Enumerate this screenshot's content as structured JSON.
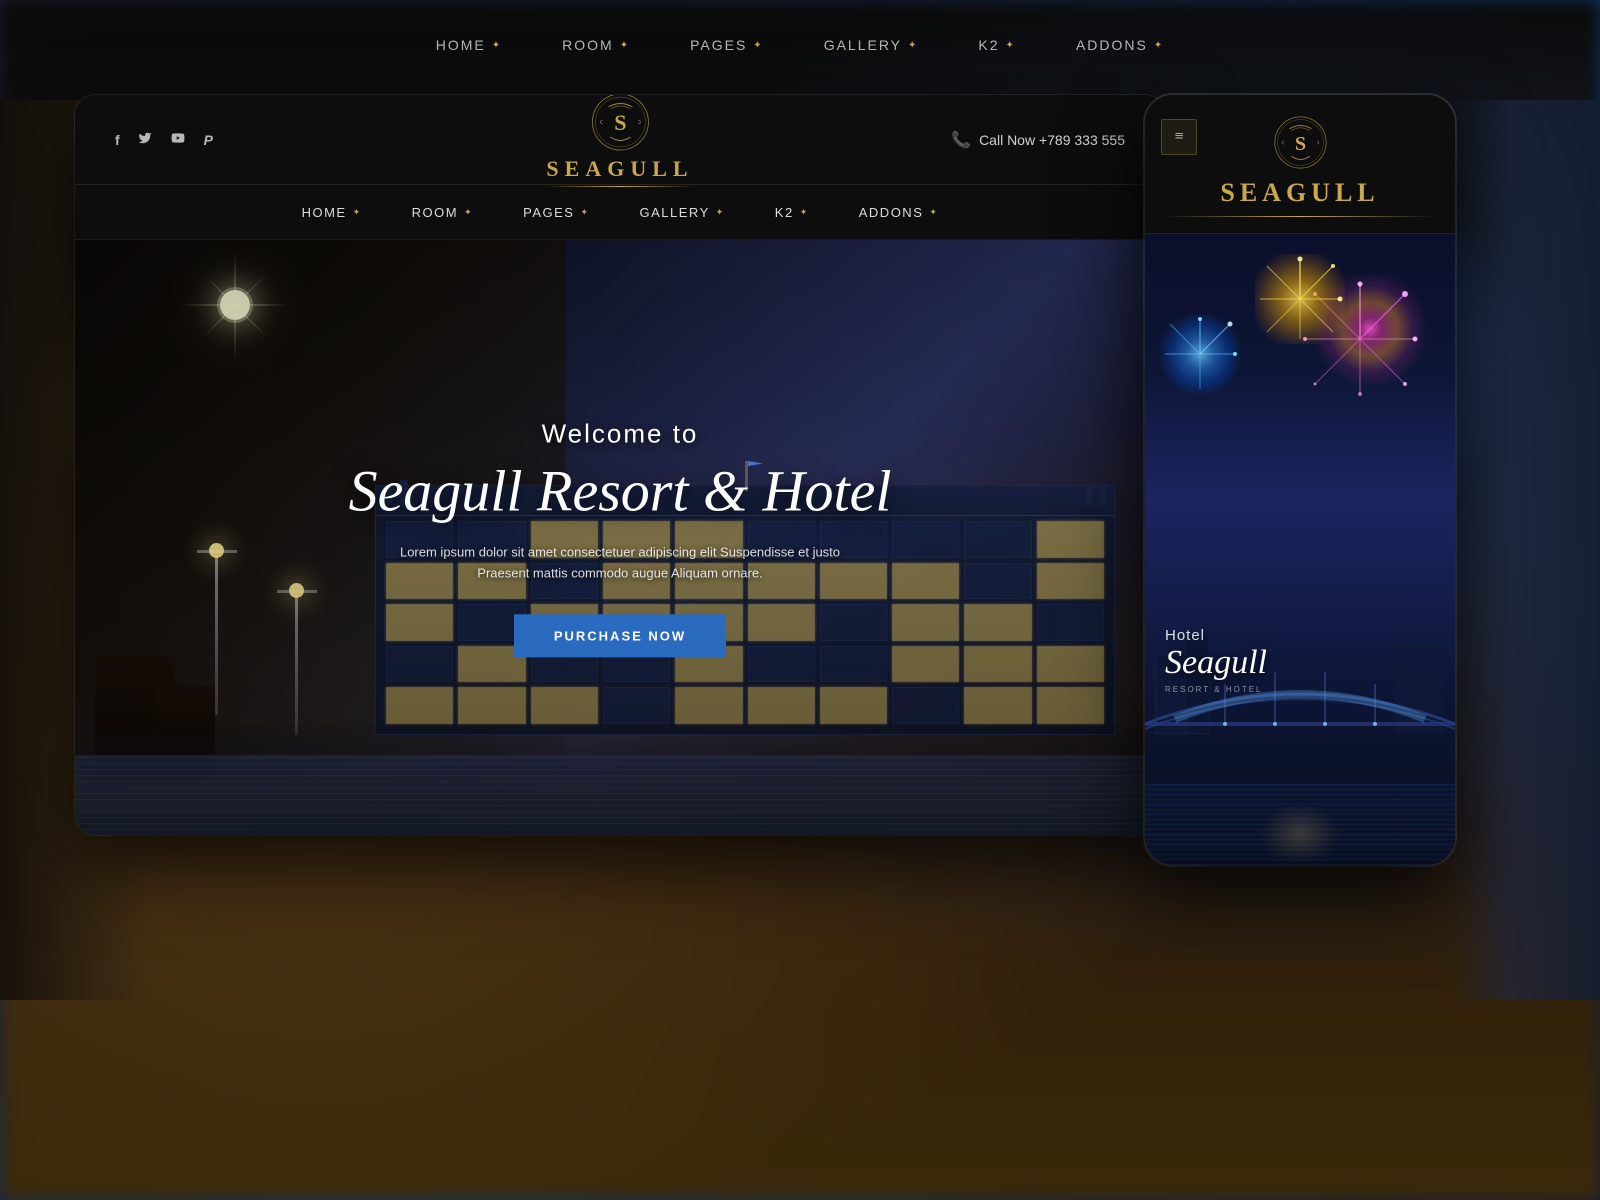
{
  "site": {
    "name": "SEAGULL",
    "tagline": "Hotel Seagull",
    "mobile_hotel_label": "Hotel",
    "mobile_hotel_name": "Seagull",
    "mobile_tagline": "RESORT & HOTEL",
    "call_now": "Call Now +789 333 555",
    "phone": "+789 333 555"
  },
  "header": {
    "social": {
      "facebook": "f",
      "twitter": "🐦",
      "youtube": "▶",
      "pinterest": "P"
    }
  },
  "top_nav": {
    "items": [
      {
        "label": "HOME",
        "has_arrow": true
      },
      {
        "label": "ROOM",
        "has_arrow": true
      },
      {
        "label": "PAGES",
        "has_arrow": true
      },
      {
        "label": "GALLERY",
        "has_arrow": true
      },
      {
        "label": "K2",
        "has_arrow": true
      },
      {
        "label": "ADDONS",
        "has_arrow": true
      }
    ]
  },
  "main_nav": {
    "items": [
      {
        "label": "HOME",
        "has_arrow": true
      },
      {
        "label": "ROOM",
        "has_arrow": true
      },
      {
        "label": "PAGES",
        "has_arrow": true
      },
      {
        "label": "GALLERY",
        "has_arrow": true
      },
      {
        "label": "K2",
        "has_arrow": true
      },
      {
        "label": "ADDONS",
        "has_arrow": true
      }
    ]
  },
  "hero": {
    "welcome": "Welcome to",
    "title": "Seagull Resort & Hotel",
    "description": "Lorem ipsum dolor sit amet consectetuer adipiscing elit Suspendisse et justo\nPraesent mattis commodo augue Aliquam ornare.",
    "cta_label": "PURCHASE NOW"
  }
}
